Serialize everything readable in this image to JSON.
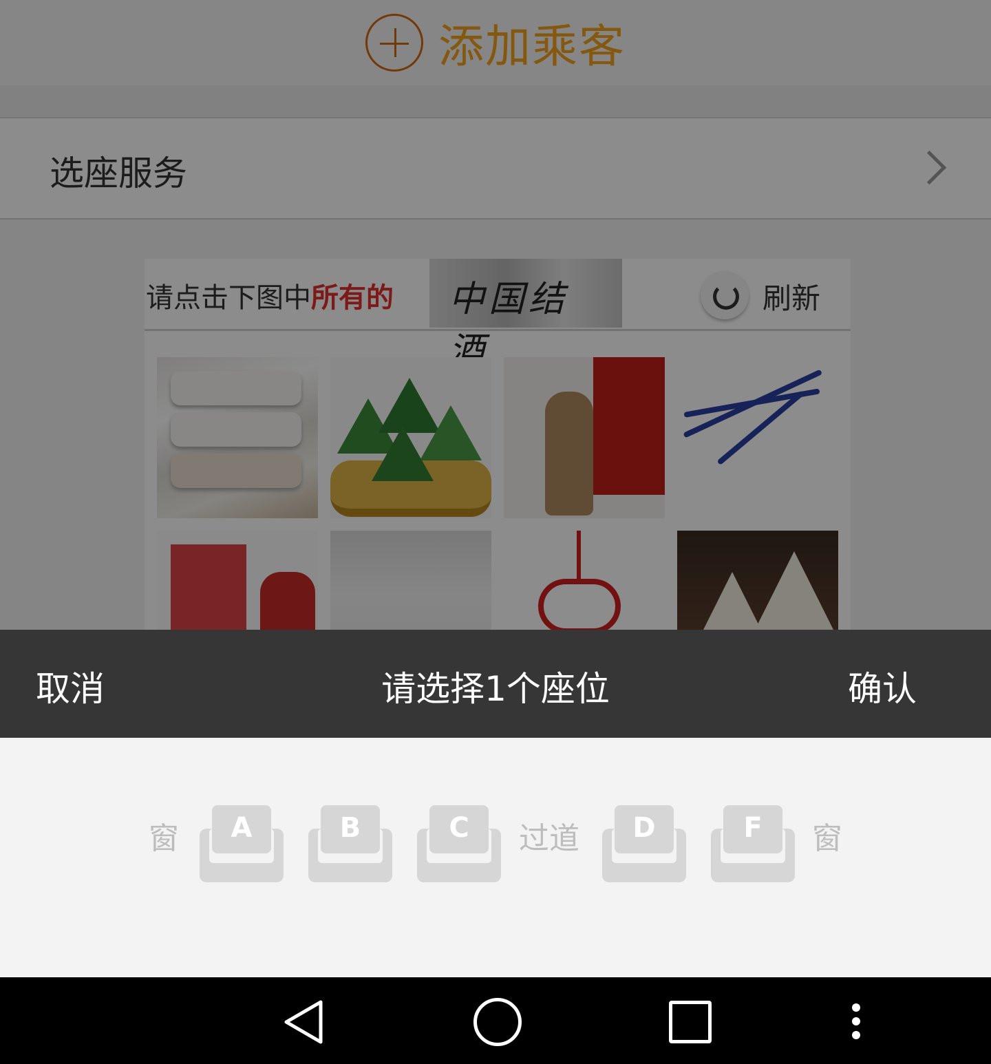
{
  "background_page": {
    "add_passenger_label": "添加乘客",
    "seat_service_label": "选座服务"
  },
  "captcha": {
    "prompt_normal": "请点击下图中",
    "prompt_highlight": "所有的",
    "keyword": "中国结 酒",
    "refresh_label": "刷新",
    "tiles": [
      "pillows",
      "zongzi-basket",
      "liquor-bottle",
      "stethoscope",
      "liquor-box",
      "fabric",
      "chinese-knot",
      "zongzi-closeup"
    ]
  },
  "sheet": {
    "cancel_label": "取消",
    "title": "请选择1个座位",
    "confirm_label": "确认"
  },
  "seat_map": {
    "left_window_label": "窗",
    "aisle_label": "过道",
    "right_window_label": "窗",
    "seats": [
      {
        "letter": "A"
      },
      {
        "letter": "B"
      },
      {
        "letter": "C"
      },
      {
        "letter": "D"
      },
      {
        "letter": "F"
      }
    ]
  },
  "nav_bar": {
    "icons": [
      "back-icon",
      "home-icon",
      "recent-apps-icon",
      "menu-icon"
    ]
  },
  "colors": {
    "accent_orange": "#f0a01a",
    "sheet_bar": "#363636",
    "seat_gray": "#d6d6d6",
    "prompt_highlight": "#e23030"
  }
}
